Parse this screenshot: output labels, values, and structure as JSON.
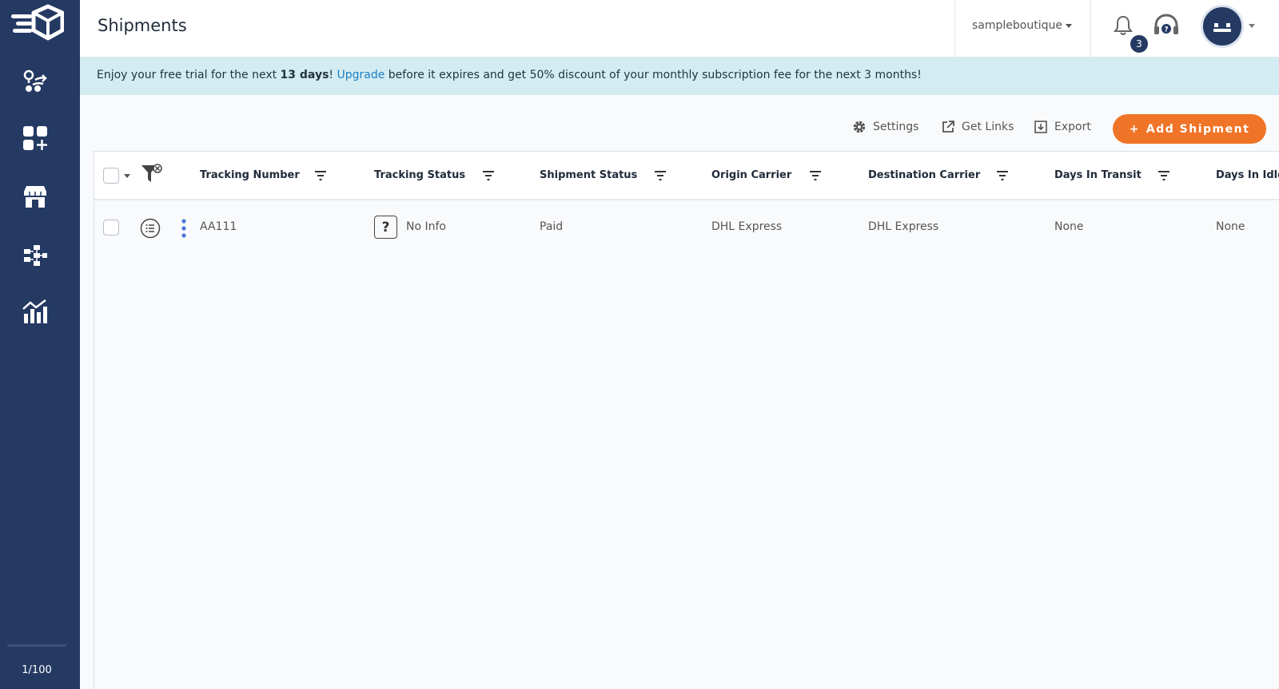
{
  "sidebar": {
    "items": [
      {
        "name": "route-icon"
      },
      {
        "name": "add-apps-icon"
      },
      {
        "name": "store-icon"
      },
      {
        "name": "hierarchy-icon"
      },
      {
        "name": "analytics-icon"
      }
    ],
    "usage_count": "1/100"
  },
  "header": {
    "title": "Shipments",
    "store_name": "sampleboutique",
    "notification_count": "3"
  },
  "banner": {
    "prefix": "Enjoy your free trial for the next ",
    "days": "13 days",
    "exclaim": "! ",
    "upgrade_link": "Upgrade",
    "suffix": " before it expires and get 50% discount of your monthly subscription fee for the next 3 months!"
  },
  "toolbar": {
    "settings_label": "Settings",
    "get_links_label": "Get Links",
    "export_label": "Export",
    "add_shipment_label": "Add Shipment",
    "add_shipment_plus": "+"
  },
  "table": {
    "columns": [
      "Tracking Number",
      "Tracking Status",
      "Shipment Status",
      "Origin Carrier",
      "Destination Carrier",
      "Days In Transit",
      "Days In Idle"
    ],
    "rows": [
      {
        "tracking_number": "AA111",
        "tracking_status_icon": "?",
        "tracking_status": "No Info",
        "shipment_status": "Paid",
        "origin_carrier": "DHL Express",
        "destination_carrier": "DHL Express",
        "days_in_transit": "None",
        "days_in_idle": "None"
      }
    ]
  },
  "colors": {
    "sidebar": "#243a63",
    "accent": "#f07427",
    "banner": "#d3ecf1",
    "link": "#1c7fc4",
    "row_menu": "#4a78d6"
  }
}
